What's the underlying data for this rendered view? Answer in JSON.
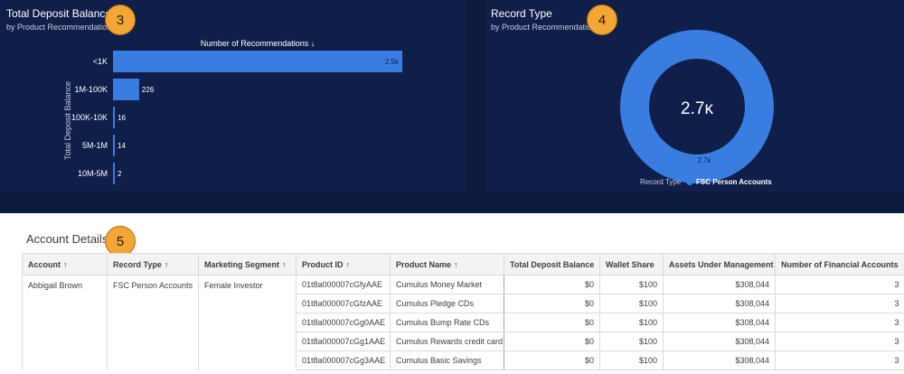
{
  "left_panel": {
    "title": "Total Deposit Balance",
    "subtitle": "by Product Recommendations",
    "badge": "3"
  },
  "right_panel": {
    "title": "Record Type",
    "subtitle": "by Product Recommendations",
    "badge": "4"
  },
  "account_section": {
    "title": "Account Details",
    "badge": "5"
  },
  "colors": {
    "bar": "#3a7de0",
    "donut": "#3a7de0",
    "panel": "#0f1f4a"
  },
  "chart_data": [
    {
      "type": "bar",
      "orientation": "horizontal",
      "title": "Total Deposit Balance",
      "subtitle": "by Product Recommendations",
      "xlabel": "Number of Recommendations ↓",
      "ylabel": "Total Deposit Balance",
      "categories": [
        "<1K",
        "1M-100K",
        "100K-10K",
        "5M-1M",
        "10M-5M"
      ],
      "values": [
        2500,
        226,
        16,
        14,
        2
      ],
      "data_labels": [
        "2.5k",
        "226",
        "16",
        "14",
        "2"
      ],
      "xlim": [
        0,
        2500
      ]
    },
    {
      "type": "pie",
      "donut": true,
      "title": "Record Type",
      "subtitle": "by Product Recommendations",
      "center_label": "2.7ĸ",
      "legend_title": "Record Type",
      "legend_position": "bottom",
      "slices": [
        {
          "label": "FSC Person Accounts",
          "value": 2700,
          "data_label": "2.7ĸ"
        }
      ]
    }
  ],
  "table": {
    "columns": [
      {
        "label": "Account",
        "sort": "↑"
      },
      {
        "label": "Record Type",
        "sort": "↑"
      },
      {
        "label": "Marketing Segment",
        "sort": "↑"
      },
      {
        "label": "Product ID",
        "sort": "↑"
      },
      {
        "label": "Product Name",
        "sort": "↑"
      },
      {
        "label": "Total Deposit Balance",
        "sort": ""
      },
      {
        "label": "Wallet Share",
        "sort": ""
      },
      {
        "label": "Assets Under Management",
        "sort": ""
      },
      {
        "label": "Number of Financial Accounts",
        "sort": ""
      }
    ],
    "group": {
      "account": "Abbigail Brown",
      "record_type": "FSC Person Accounts",
      "segment": "Female Investor"
    },
    "rows": [
      {
        "product_id": "01t8a000007cGfyAAE",
        "product_name": "Cumulus Money Market",
        "deposit": "$0",
        "wallet": "$100",
        "aum": "$308,044",
        "accounts": "3"
      },
      {
        "product_id": "01t8a000007cGfzAAE",
        "product_name": "Cumulus Pledge CDs",
        "deposit": "$0",
        "wallet": "$100",
        "aum": "$308,044",
        "accounts": "3"
      },
      {
        "product_id": "01t8a000007cGg0AAE",
        "product_name": "Cumulus Bump Rate CDs",
        "deposit": "$0",
        "wallet": "$100",
        "aum": "$308,044",
        "accounts": "3"
      },
      {
        "product_id": "01t8a000007cGg1AAE",
        "product_name": "Cumulus Rewards credit card",
        "deposit": "$0",
        "wallet": "$100",
        "aum": "$308,044",
        "accounts": "3"
      },
      {
        "product_id": "01t8a000007cGg3AAE",
        "product_name": "Cumulus Basic Savings",
        "deposit": "$0",
        "wallet": "$100",
        "aum": "$308,044",
        "accounts": "3"
      }
    ]
  }
}
